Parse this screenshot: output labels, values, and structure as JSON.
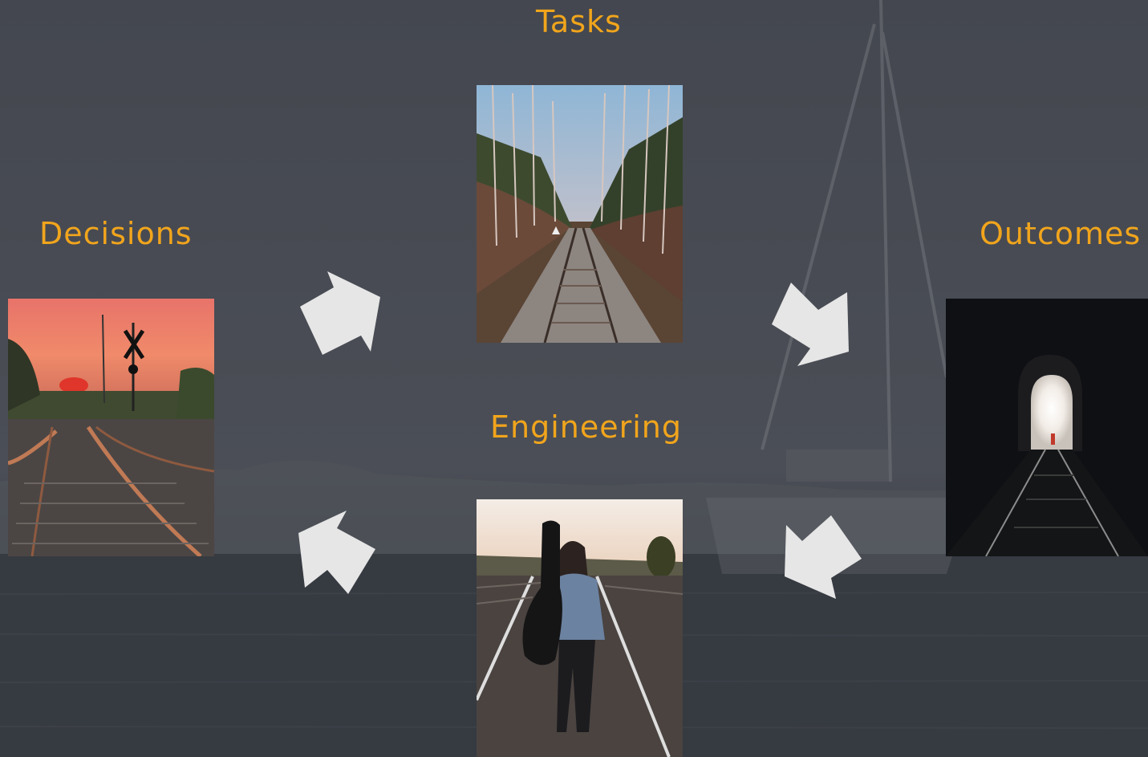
{
  "nodes": {
    "tasks": {
      "label": "Tasks",
      "photo": "forest railway track"
    },
    "decisions": {
      "label": "Decisions",
      "photo": "railway at sunset with crossing sign"
    },
    "outcomes": {
      "label": "Outcomes",
      "photo": "railway tunnel with light at the end"
    },
    "engineering": {
      "label": "Engineering",
      "photo": "person with guitar case walking on railway"
    }
  },
  "cycle": [
    "Decisions",
    "Tasks",
    "Outcomes",
    "Engineering"
  ],
  "colors": {
    "background": "#474a52",
    "label": "#f1a51c",
    "arrow": "#e6e6e6"
  },
  "icons": [
    "cycle-arrow-icon"
  ]
}
